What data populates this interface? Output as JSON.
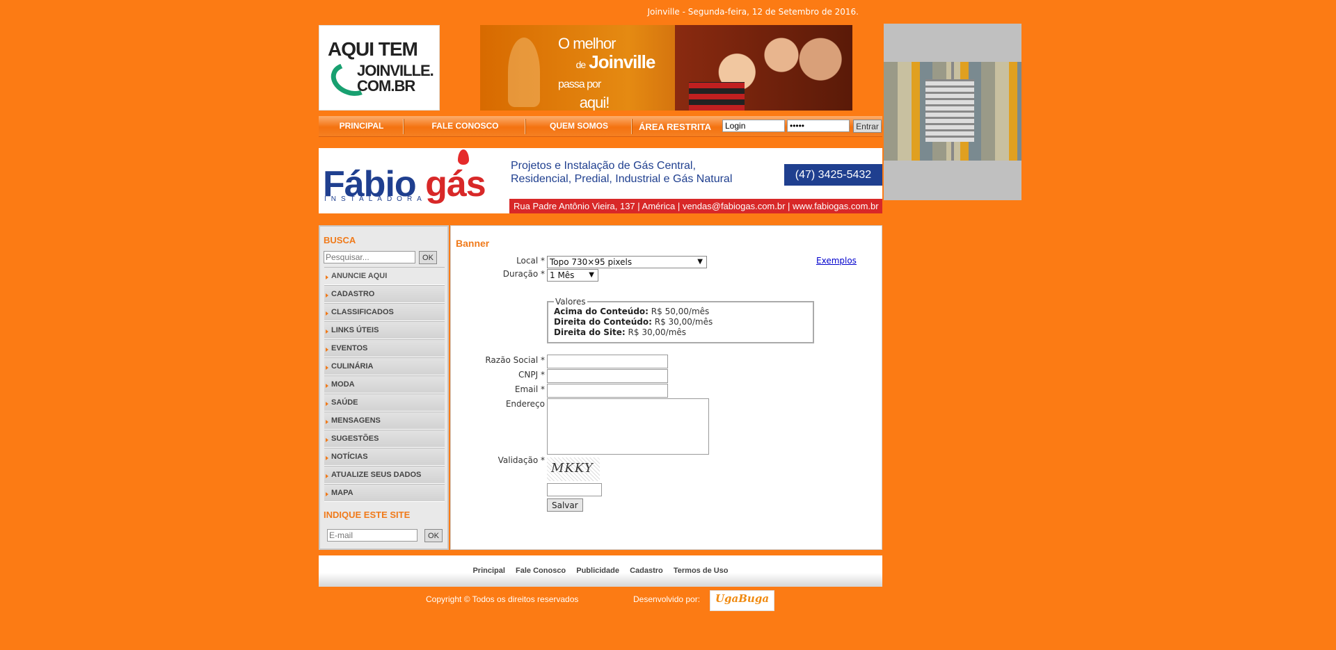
{
  "header": {
    "date_text": "Joinville - Segunda-feira, 12 de Setembro de 2016.",
    "logo": {
      "line1": "AQUI TEM",
      "line2": "JOINVILLE.",
      "line3": "COM.BR"
    },
    "top_banner": {
      "line1": "O melhor",
      "line2": "de",
      "line3": "Joinville",
      "line4": "passa por",
      "line5": "aqui!"
    }
  },
  "nav": {
    "items": [
      "PRINCIPAL",
      "FALE CONOSCO",
      "QUEM SOMOS"
    ],
    "restricted_label": "ÁREA RESTRITA",
    "login_value": "Login",
    "password_value": "•••••",
    "enter_label": "Entrar"
  },
  "sponsor": {
    "name_part1": "Fábio",
    "name_part2": "gás",
    "subtitle": "INSTALADORA",
    "desc_line1": "Projetos e Instalação de Gás Central,",
    "desc_line2": "Residencial, Predial, Industrial e Gás Natural",
    "phone": "(47) 3425-5432",
    "address": "Rua Padre Antônio Vieira, 137 | América | vendas@fabiogas.com.br | www.fabiogas.com.br"
  },
  "sidebar": {
    "search_heading": "BUSCA",
    "search_placeholder": "Pesquisar...",
    "ok_label": "OK",
    "menu": [
      "ANUNCIE AQUI",
      "CADASTRO",
      "CLASSIFICADOS",
      "LINKS ÚTEIS",
      "EVENTOS",
      "CULINÁRIA",
      "MODA",
      "SAÚDE",
      "MENSAGENS",
      "SUGESTÕES",
      "NOTÍCIAS",
      "ATUALIZE SEUS DADOS",
      "MAPA"
    ],
    "indique_heading": "INDIQUE ESTE SITE",
    "email_placeholder": "E-mail",
    "ok2_label": "OK"
  },
  "form": {
    "title": "Banner",
    "local_label": "Local *",
    "local_value": "Topo 730×95 pixels",
    "exemplos": "Exemplos",
    "duracao_label": "Duração *",
    "duracao_value": "1 Mês",
    "valores_legend": "Valores",
    "valores": [
      {
        "k": "Acima do Conteúdo:",
        "v": "R$ 50,00/mês"
      },
      {
        "k": "Direita do Conteúdo:",
        "v": "R$ 30,00/mês"
      },
      {
        "k": "Direita do Site:",
        "v": "R$ 30,00/mês"
      }
    ],
    "razao_label": "Razão Social *",
    "cnpj_label": "CNPJ *",
    "email_label": "Email *",
    "endereco_label": "Endereço",
    "validacao_label": "Validação *",
    "captcha_text": "MKKY",
    "save_label": "Salvar"
  },
  "footer": {
    "links": [
      "Principal",
      "Fale Conosco",
      "Publicidade",
      "Cadastro",
      "Termos de Uso"
    ],
    "copyright": "Copyright © Todos os direitos reservados",
    "developed_by": "Desenvolvido por:",
    "dev_logo": "UgaBuga"
  }
}
